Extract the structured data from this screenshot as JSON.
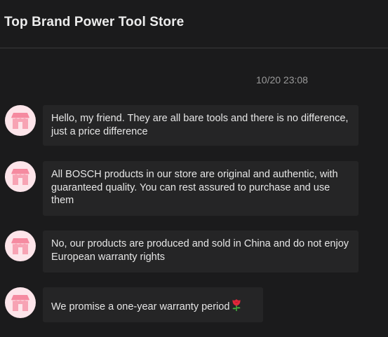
{
  "header": {
    "title": "Top Brand Power Tool Store"
  },
  "chat": {
    "timestamp": "10/20 23:08",
    "avatar_icon": "shop-avatar-icon",
    "avatar_color": "#fde5ea",
    "messages": [
      {
        "text": "Hello, my friend. They are all bare tools and there is no difference, just a price difference"
      },
      {
        "text": "All BOSCH products in our store are original and authentic, with guaranteed quality. You can rest assured to purchase and use them"
      },
      {
        "text": "No, our products are produced and sold in China and do not enjoy European warranty rights"
      },
      {
        "text": "We promise a one-year warranty period",
        "emoji": "rose-emoji-icon"
      }
    ]
  }
}
